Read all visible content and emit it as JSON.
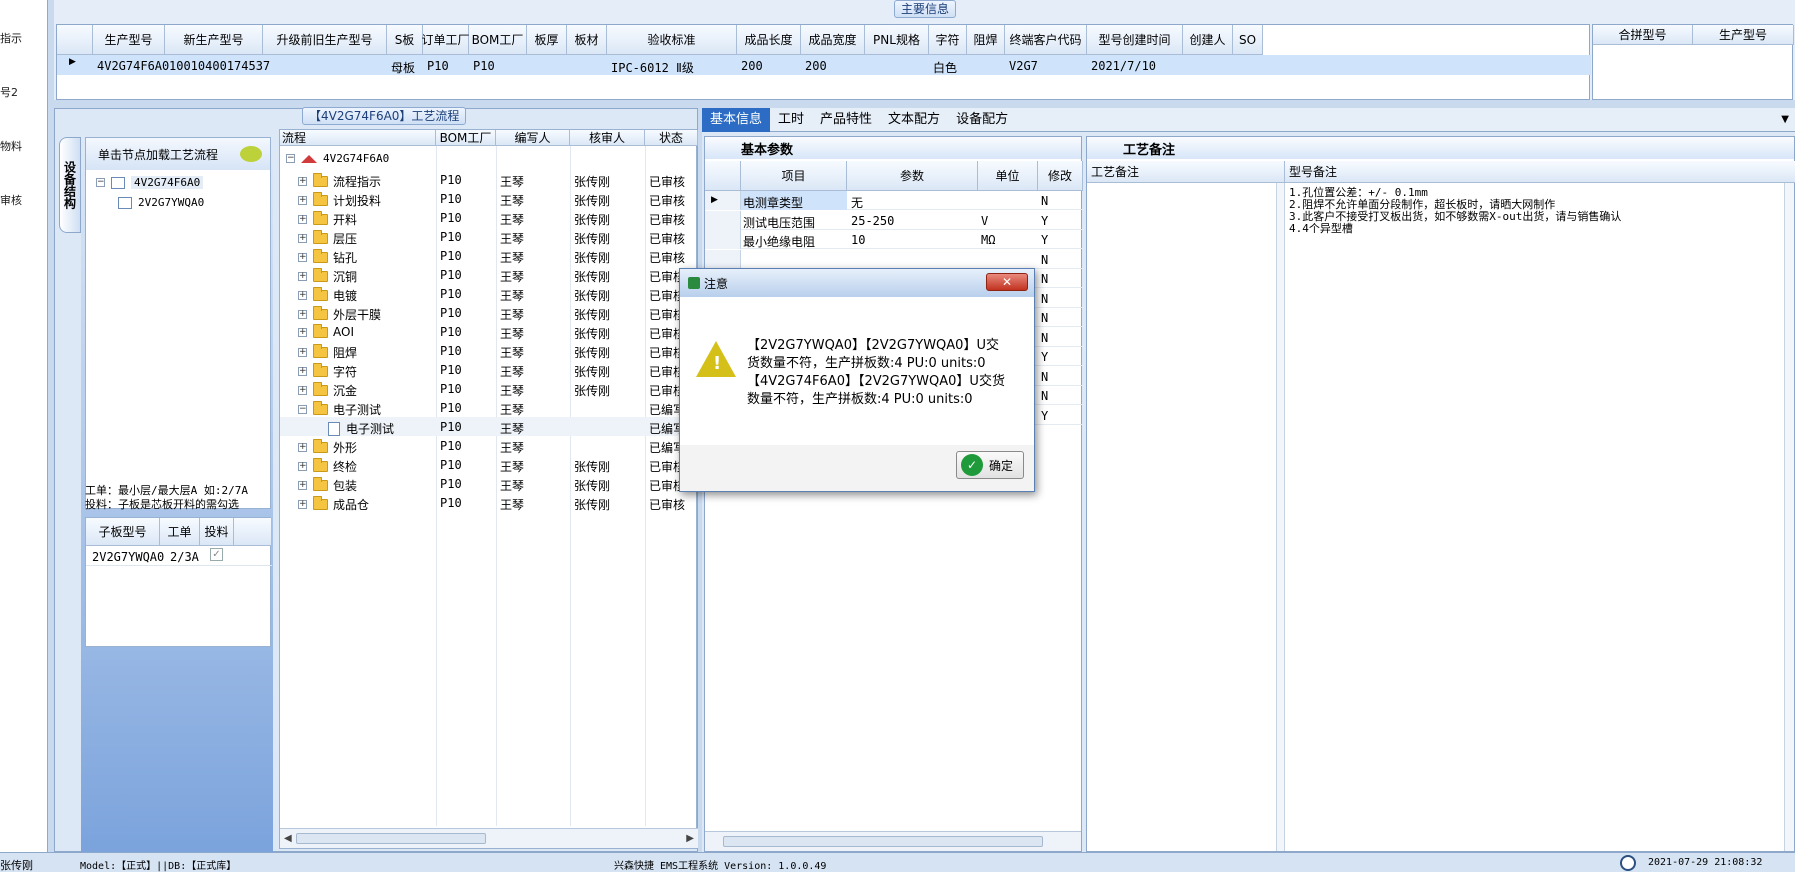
{
  "left_nav": [
    {
      "label": "指示"
    },
    {
      "label": "号2"
    },
    {
      "label": "物料"
    },
    {
      "label": "审核"
    }
  ],
  "main_info": {
    "title": "主要信息",
    "columns": [
      "生产型号",
      "新生产型号",
      "升级前旧生产型号",
      "S板",
      "订单工厂",
      "BOM工厂",
      "板厚",
      "板材",
      "验收标准",
      "成品长度",
      "成品宽度",
      "PNL规格",
      "字符",
      "阻焊",
      "终端客户代码",
      "型号创建时间",
      "创建人",
      "SO"
    ],
    "row": {
      "生产型号": "4V2G74F6A0",
      "新生产型号": "10010400174537",
      "S板": "母板",
      "订单工厂": "P10",
      "BOM工厂": "P10",
      "验收标准": "IPC-6012 Ⅱ级",
      "成品长度": "200",
      "成品宽度": "200",
      "字符": "白色",
      "终端客户代码": "V2G7",
      "型号创建时间": "2021/7/10"
    },
    "right_columns": [
      "合拼型号",
      "生产型号"
    ]
  },
  "process_flow": {
    "caption": "【4V2G74F6A0】工艺流程",
    "side_tab": "设备结构",
    "hint": "单击节点加载工艺流程",
    "tree_nodes": [
      "4V2G74F6A0",
      "2V2G7YWQA0"
    ],
    "notes": [
      "工单：最小层/最大层A 如:2/7A",
      "投料：子板是芯板开料的需勾选"
    ],
    "subboard_columns": [
      "子板型号",
      "工单",
      "投料"
    ],
    "subboard_rows": [
      {
        "model": "2V2G7YWQA0",
        "order": "2/3A",
        "feed": "✓"
      }
    ],
    "flow_columns": [
      "流程",
      "BOM工厂",
      "编写人",
      "核审人",
      "状态"
    ],
    "root": "4V2G74F6A0",
    "steps": [
      {
        "name": "流程指示",
        "bom": "P10",
        "writer": "王琴",
        "reviewer": "张传刚",
        "status": "已审核"
      },
      {
        "name": "计划投料",
        "bom": "P10",
        "writer": "王琴",
        "reviewer": "张传刚",
        "status": "已审核"
      },
      {
        "name": "开料",
        "bom": "P10",
        "writer": "王琴",
        "reviewer": "张传刚",
        "status": "已审核"
      },
      {
        "name": "层压",
        "bom": "P10",
        "writer": "王琴",
        "reviewer": "张传刚",
        "status": "已审核"
      },
      {
        "name": "钻孔",
        "bom": "P10",
        "writer": "王琴",
        "reviewer": "张传刚",
        "status": "已审核"
      },
      {
        "name": "沉铜",
        "bom": "P10",
        "writer": "王琴",
        "reviewer": "张传刚",
        "status": "已审核"
      },
      {
        "name": "电镀",
        "bom": "P10",
        "writer": "王琴",
        "reviewer": "张传刚",
        "status": "已审核"
      },
      {
        "name": "外层干膜",
        "bom": "P10",
        "writer": "王琴",
        "reviewer": "张传刚",
        "status": "已审核"
      },
      {
        "name": "AOI",
        "bom": "P10",
        "writer": "王琴",
        "reviewer": "张传刚",
        "status": "已审核"
      },
      {
        "name": "阻焊",
        "bom": "P10",
        "writer": "王琴",
        "reviewer": "张传刚",
        "status": "已审核"
      },
      {
        "name": "字符",
        "bom": "P10",
        "writer": "王琴",
        "reviewer": "张传刚",
        "status": "已审核"
      },
      {
        "name": "沉金",
        "bom": "P10",
        "writer": "王琴",
        "reviewer": "张传刚",
        "status": "已审核"
      },
      {
        "name": "电子测试",
        "bom": "P10",
        "writer": "王琴",
        "reviewer": "",
        "status": "已编写"
      },
      {
        "name": "电子测试",
        "bom": "P10",
        "writer": "王琴",
        "reviewer": "",
        "status": "已编写",
        "child": true
      },
      {
        "name": "外形",
        "bom": "P10",
        "writer": "王琴",
        "reviewer": "",
        "status": "已编写"
      },
      {
        "name": "终检",
        "bom": "P10",
        "writer": "王琴",
        "reviewer": "张传刚",
        "status": "已审核"
      },
      {
        "name": "包装",
        "bom": "P10",
        "writer": "王琴",
        "reviewer": "张传刚",
        "status": "已审核"
      },
      {
        "name": "成品仓",
        "bom": "P10",
        "writer": "王琴",
        "reviewer": "张传刚",
        "status": "已审核"
      }
    ]
  },
  "tabs": [
    "基本信息",
    "工时",
    "产品特性",
    "文本配方",
    "设备配方"
  ],
  "basic_params": {
    "title": "基本参数",
    "columns": [
      "项目",
      "参数",
      "单位",
      "修改"
    ],
    "rows": [
      {
        "item": "电测章类型",
        "param": "无",
        "unit": "",
        "mod": "N"
      },
      {
        "item": "测试电压范围",
        "param": "25-250",
        "unit": "V",
        "mod": "Y"
      },
      {
        "item": "最小绝缘电阻",
        "param": "10",
        "unit": "MΩ",
        "mod": "Y"
      },
      {
        "item": "",
        "param": "",
        "unit": "",
        "mod": "N"
      },
      {
        "item": "",
        "param": "",
        "unit": "",
        "mod": "N"
      },
      {
        "item": "",
        "param": "",
        "unit": "",
        "mod": "N"
      },
      {
        "item": "",
        "param": "",
        "unit": "",
        "mod": "N"
      },
      {
        "item": "",
        "param": "",
        "unit": "",
        "mod": "N"
      },
      {
        "item": "",
        "param": "",
        "unit": "",
        "mod": "Y"
      },
      {
        "item": "",
        "param": "",
        "unit": "",
        "mod": "N"
      },
      {
        "item": "",
        "param": "",
        "unit": "",
        "mod": "N"
      },
      {
        "item": "",
        "param": "",
        "unit": "",
        "mod": "Y"
      }
    ]
  },
  "process_notes": {
    "title": "工艺备注",
    "col1": "工艺备注",
    "col2": "型号备注",
    "model_notes": [
      "1.孔位置公差：+/- 0.1mm",
      "2.阻焊不允许单面分段制作，超长板时，请晒大网制作",
      "3.此客户不接受打叉板出货，如不够数需X-out出货，请与销售确认",
      "4.4个异型槽"
    ]
  },
  "dialog": {
    "title": "注意",
    "message_lines": [
      "【2V2G7YWQA0】【2V2G7YWQA0】U交",
      "货数量不符，生产拼板数:4 PU:0 units:0",
      "【4V2G74F6A0】【2V2G7YWQA0】U交货",
      "数量不符，生产拼板数:4 PU:0 units:0"
    ],
    "ok": "确定"
  },
  "status_bar": {
    "user": "张传刚",
    "model": "Model:【正式】||DB:【正式库】",
    "app": "兴森快捷 EMS工程系统 Version: 1.0.0.49",
    "datetime": "2021-07-29 21:08:32"
  }
}
